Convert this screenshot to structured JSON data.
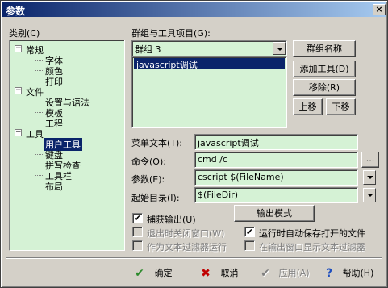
{
  "window": {
    "title": "参数",
    "close_glyph": "×"
  },
  "category": {
    "label": "类别(C)",
    "tree": [
      {
        "label": "常规",
        "level": 0,
        "expanded": true
      },
      {
        "label": "字体",
        "level": 1
      },
      {
        "label": "颜色",
        "level": 1
      },
      {
        "label": "打印",
        "level": 1
      },
      {
        "label": "文件",
        "level": 0,
        "expanded": true
      },
      {
        "label": "设置与语法",
        "level": 1
      },
      {
        "label": "模板",
        "level": 1
      },
      {
        "label": "工程",
        "level": 1
      },
      {
        "label": "工具",
        "level": 0,
        "expanded": true
      },
      {
        "label": "用户工具",
        "level": 1,
        "selected": true
      },
      {
        "label": "键盘",
        "level": 1
      },
      {
        "label": "拼写检查",
        "level": 1
      },
      {
        "label": "工具栏",
        "level": 1
      },
      {
        "label": "布局",
        "level": 1
      }
    ]
  },
  "groups": {
    "label": "群组与工具项目(G):",
    "selected_group": "群组 3",
    "items": [
      "javascript调试"
    ],
    "buttons": {
      "group_name": "群组名称",
      "add_tool": "添加工具(D)",
      "remove": "移除(R)",
      "move_up": "上移",
      "move_down": "下移"
    }
  },
  "form": {
    "menu_text_label": "菜单文本(T):",
    "menu_text_value": "javascript调试",
    "command_label": "命令(O):",
    "command_value": "cmd /c",
    "browse_label": "...",
    "args_label": "参数(E):",
    "args_value": "cscript $(FileName)",
    "start_dir_label": "起始目录(I):",
    "start_dir_value": "$(FileDir)",
    "output_mode_button": "输出模式"
  },
  "options": {
    "capture_output": {
      "label": "捕获输出(U)",
      "checked": true,
      "enabled": true
    },
    "close_on_exit": {
      "label": "退出时关闭窗口(W)",
      "checked": false,
      "enabled": false
    },
    "run_as_filter": {
      "label": "作为文本过滤器运行",
      "checked": false,
      "enabled": false
    },
    "auto_save": {
      "label": "运行时自动保存打开的文件",
      "checked": true,
      "enabled": true
    },
    "show_filter_in_output": {
      "label": "在输出窗口显示文本过滤器",
      "checked": false,
      "enabled": false
    },
    "check_glyph": "✔"
  },
  "footer": {
    "ok": "确定",
    "cancel": "取消",
    "apply": "应用(A)",
    "help": "帮助(H)",
    "ok_icon": "✔",
    "cancel_icon": "✖",
    "apply_icon": "✔",
    "help_icon": "?"
  },
  "colors": {
    "title_start": "#0a246a",
    "title_end": "#a6caf0",
    "list_bg": "#d5f2d5",
    "selection": "#0a246a",
    "ok_icon": "#2e8b2e",
    "cancel_icon": "#c00000",
    "help_icon": "#1e4fbf"
  }
}
